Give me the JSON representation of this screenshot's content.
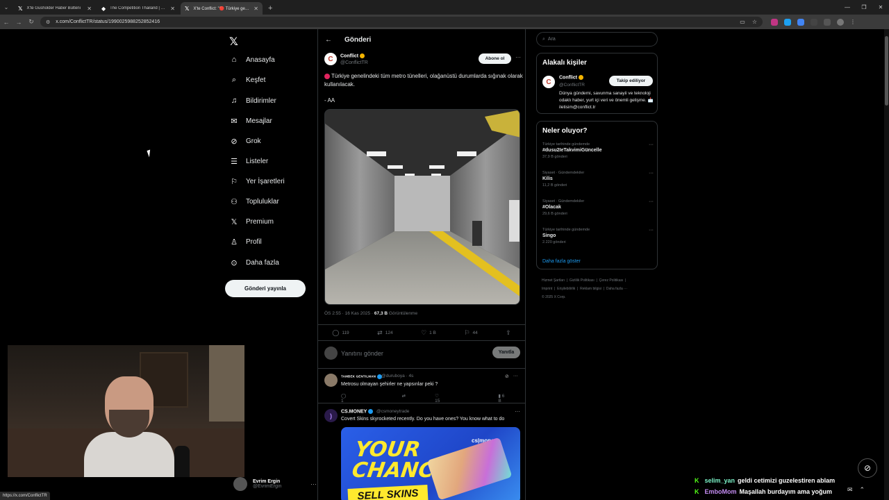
{
  "browser": {
    "tabs": [
      {
        "title": "X'te Gusholder Haber Bülteni",
        "active": false
      },
      {
        "title": "The Competition Thailand | Mi...",
        "active": false
      },
      {
        "title": "X'te Conflict: \"🔴 Türkiye geneli...",
        "active": true
      }
    ],
    "url": "x.com/ConflictTR/status/1990025988252852416",
    "status_url": "https://x.com/ConflictTR"
  },
  "nav": {
    "items": [
      {
        "label": "Anasayfa",
        "icon": "home-icon"
      },
      {
        "label": "Keşfet",
        "icon": "search-icon"
      },
      {
        "label": "Bildirimler",
        "icon": "bell-icon"
      },
      {
        "label": "Mesajlar",
        "icon": "mail-icon"
      },
      {
        "label": "Grok",
        "icon": "grok-icon"
      },
      {
        "label": "Listeler",
        "icon": "list-icon"
      },
      {
        "label": "Yer İşaretleri",
        "icon": "bookmark-icon"
      },
      {
        "label": "Topluluklar",
        "icon": "people-icon"
      },
      {
        "label": "Premium",
        "icon": "x-logo-icon"
      },
      {
        "label": "Profil",
        "icon": "person-icon"
      },
      {
        "label": "Daha fazla",
        "icon": "more-circle-icon"
      }
    ],
    "post_button": "Gönderi yayınla",
    "account": {
      "name": "Evrim Ergin",
      "handle": "@EvrimErgin"
    }
  },
  "main": {
    "header": "Gönderi",
    "tweet": {
      "name": "Conflict",
      "handle": "@ConflictTR",
      "follow_label": "Abone ol",
      "text": "Türkiye genelindeki tüm metro tünelleri, olağanüstü durumlarda sığınak olarak kullanılacak.",
      "source": "- AA",
      "time": "ÖS 2:55 · 16 Kas 2025 · ",
      "views": "67,3 B",
      "views_label": " Görüntülenme",
      "replies": "119",
      "retweets": "124",
      "likes": "1 B",
      "bookmarks": "44"
    },
    "reply": {
      "placeholder": "Yanıtını gönder",
      "button": "Yanıtla"
    },
    "post2": {
      "name": "TAMBEK GENTILMAN",
      "handle": "@duruboya · 4s",
      "text": "Metrosu olmayan şehirler ne yapsınlar peki ?",
      "replies": "1",
      "likes": "15",
      "views": "6 B"
    },
    "post3": {
      "name": "CS.MONEY",
      "handle": "@csmoneytrade",
      "text": "Covert Skins skyrocketed recently. Do you have ones? You know what to do",
      "ad_headline": "YOUR CHANCE",
      "ad_band": "SELL SKINS",
      "ad_logo": "cs|money"
    }
  },
  "right": {
    "search_placeholder": "Ara",
    "related_title": "Alakalı kişiler",
    "related": {
      "name": "Conflict",
      "handle": "@ConflictTR",
      "button": "Takip ediliyor",
      "bio": "Dünya gündemi, savunma sanayii ve teknoloji odaklı haber, yurt içi veri ve önemli gelişme. 📩 iletisim@conflict.tr"
    },
    "trends_title": "Neler oluyor?",
    "trends": [
      {
        "category": "Türkiye tarihinde gündemde",
        "title": "#dusu2IeTakvimiGüncelle",
        "count": "37,9 B gönderi"
      },
      {
        "category": "Siyaset · Gündemdekiler",
        "title": "Kilis",
        "count": "11,2 B gönderi"
      },
      {
        "category": "Siyaset · Gündemdekiler",
        "title": "#Olacak",
        "count": "29,6 B gönderi"
      },
      {
        "category": "Türkiye tarihinde gündemde",
        "title": "Singo",
        "count": "2.220 gönderi"
      }
    ],
    "show_more": "Daha fazla göster",
    "footer": [
      "Hizmet Şartları",
      "Gizlilik Politikası",
      "Çerez Politikası",
      "Imprint",
      "Erişilebilirlik",
      "Reklam bilgisi",
      "Daha fazla ···",
      "© 2025 X Corp."
    ]
  },
  "overlay": {
    "chat": [
      {
        "user": "selim_yan",
        "message": "geldi cetimizi guzelestiren ablam"
      },
      {
        "user": "EmboMom",
        "message": "Maşallah burdayım ama yoğum"
      }
    ]
  }
}
